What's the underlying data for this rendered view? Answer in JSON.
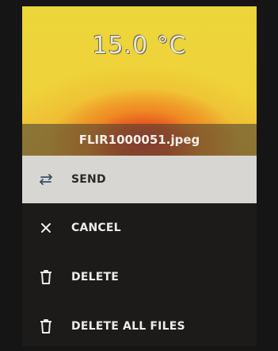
{
  "header": {
    "temperature": "15.0 °C",
    "filename": "FLIR1000051.jpeg"
  },
  "menu": {
    "items": [
      {
        "label": "SEND",
        "icon": "swap-arrows-icon",
        "selected": true
      },
      {
        "label": "CANCEL",
        "icon": "close-icon",
        "selected": false
      },
      {
        "label": "DELETE",
        "icon": "trash-icon",
        "selected": false
      },
      {
        "label": "DELETE ALL FILES",
        "icon": "trash-icon",
        "selected": false
      }
    ]
  },
  "colors": {
    "selected_background": "#d8d6d2",
    "menu_background": "#1c1b1a",
    "text_light": "#ececec",
    "text_dark": "#2b2b2b"
  }
}
